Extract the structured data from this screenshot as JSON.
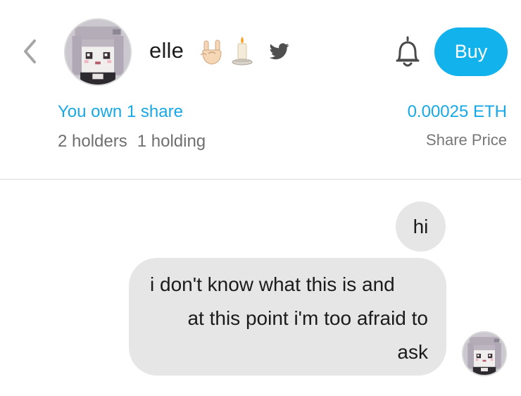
{
  "header": {
    "back_icon": "chevron-left-icon",
    "avatar": "pixel-anime-girl-avatar",
    "username": "elle",
    "emojis": [
      "sign-of-the-horns-emoji",
      "candle-emoji"
    ],
    "social_icon": "twitter-icon",
    "bell_icon": "bell-icon",
    "buy_label": "Buy"
  },
  "stats": {
    "own_text": "You own 1 share",
    "holders_text": "2 holders",
    "holding_text": "1 holding",
    "price_value": "0.00025 ETH",
    "price_label": "Share Price"
  },
  "messages": [
    {
      "text": "hi",
      "lines": [
        "hi"
      ]
    },
    {
      "text": "i don't know what this is and at this point i'm too afraid to ask",
      "lines": [
        "i don't know what this is and",
        "at this point i'm too afraid to",
        "ask"
      ]
    }
  ],
  "colors": {
    "accent": "#12b2ec",
    "accent_text": "#18a8e5",
    "bubble_bg": "#e6e6e6",
    "divider": "#dadada"
  }
}
